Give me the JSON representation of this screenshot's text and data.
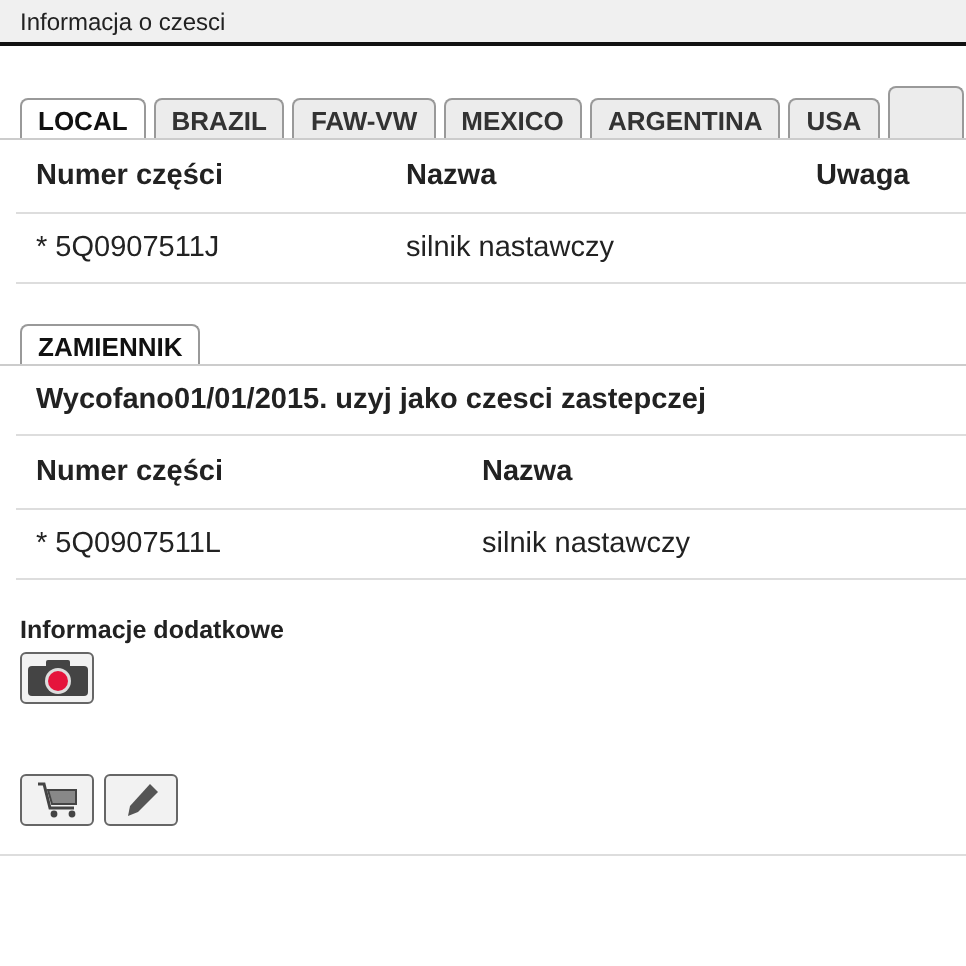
{
  "header": {
    "title": "Informacja o czesci"
  },
  "tabs": [
    {
      "label": "LOCAL",
      "selected": true
    },
    {
      "label": "BRAZIL",
      "selected": false
    },
    {
      "label": "FAW-VW",
      "selected": false
    },
    {
      "label": "MEXICO",
      "selected": false
    },
    {
      "label": "ARGENTINA",
      "selected": false
    },
    {
      "label": "USA",
      "selected": false
    }
  ],
  "parts_table": {
    "columns": [
      "Numer części",
      "Nazwa",
      "Uwaga"
    ],
    "rows": [
      [
        "* 5Q0907511J",
        "silnik nastawczy"
      ]
    ]
  },
  "replacement": {
    "tab": {
      "label": "ZAMIENNIK",
      "selected": true
    },
    "notice": "Wycofano01/01/2015. uzyj jako czesci zastepczej",
    "columns": [
      "Numer części",
      "Nazwa"
    ],
    "rows": [
      [
        "* 5Q0907511L",
        "silnik nastawczy"
      ]
    ]
  },
  "additional_info": {
    "title": "Informacje dodatkowe"
  }
}
